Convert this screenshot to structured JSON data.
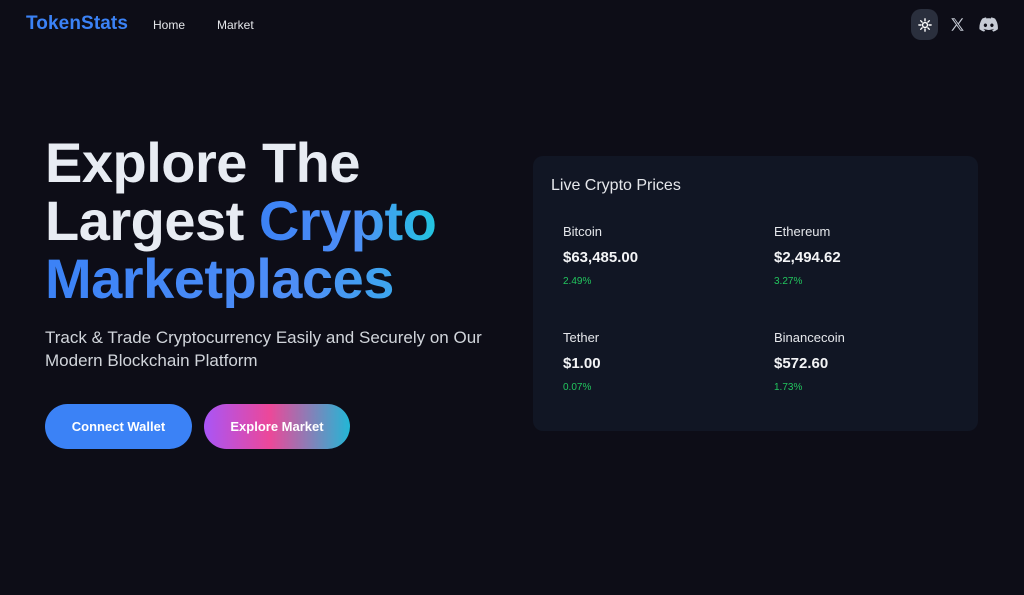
{
  "nav": {
    "logo": "TokenStats",
    "links": [
      "Home",
      "Market"
    ],
    "icons": [
      "gear-icon",
      "x-icon",
      "discord-icon"
    ]
  },
  "hero": {
    "title_line1": "Explore The",
    "title_line2_plain": "Largest ",
    "title_line2_accent": "Crypto",
    "title_line3_accent": "Marketplaces",
    "subtitle": "Track & Trade Cryptocurrency Easily and Securely on Our Modern Blockchain Platform",
    "buttons": {
      "connect": "Connect Wallet",
      "explore": "Explore Market"
    }
  },
  "prices": {
    "title": "Live Crypto Prices",
    "coins": [
      {
        "name": "Bitcoin",
        "price": "$63,485.00",
        "change": "2.49%"
      },
      {
        "name": "Ethereum",
        "price": "$2,494.62",
        "change": "3.27%"
      },
      {
        "name": "Tether",
        "price": "$1.00",
        "change": "0.07%"
      },
      {
        "name": "Binancecoin",
        "price": "$572.60",
        "change": "1.73%"
      }
    ]
  },
  "colors": {
    "background": "#0d0d17",
    "accent": "#3b82f6",
    "positive": "#22c55e",
    "panel": "#111624"
  }
}
